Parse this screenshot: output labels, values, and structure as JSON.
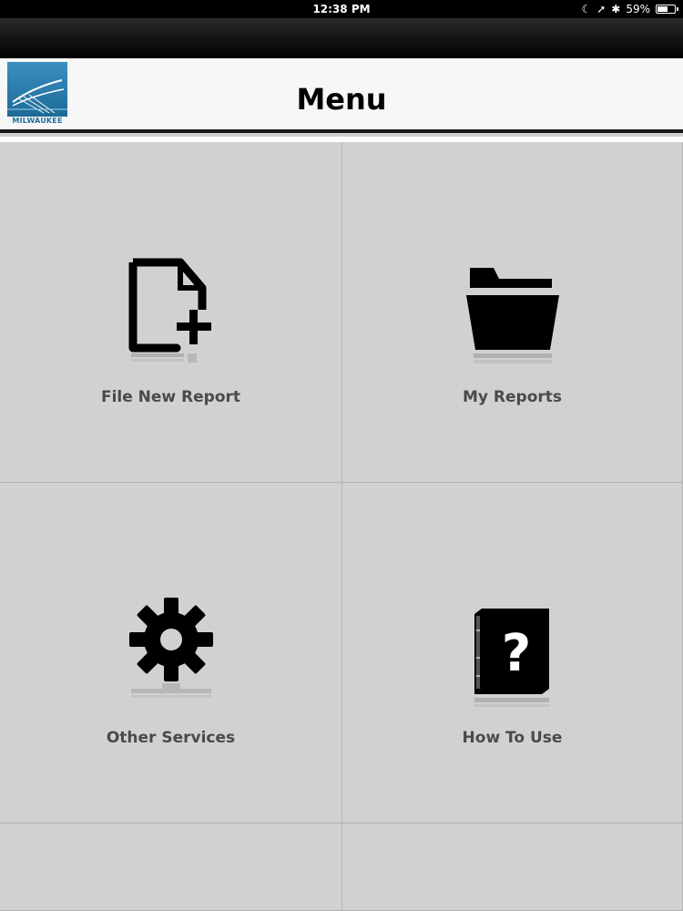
{
  "status": {
    "time": "12:38 PM",
    "battery": "59%",
    "battery_level": 0.59
  },
  "header": {
    "title": "Menu",
    "logo_text": "MILWAUKEE"
  },
  "menu": {
    "items": [
      {
        "label": "File New Report",
        "icon": "file-new-icon"
      },
      {
        "label": "My Reports",
        "icon": "folder-icon"
      },
      {
        "label": "Other Services",
        "icon": "gear-icon"
      },
      {
        "label": "How To Use",
        "icon": "help-book-icon"
      }
    ]
  },
  "colors": {
    "background": "#d1d1d3",
    "icon": "#000000",
    "label": "#4a4a4a",
    "logo_blue": "#1f6f9a"
  }
}
